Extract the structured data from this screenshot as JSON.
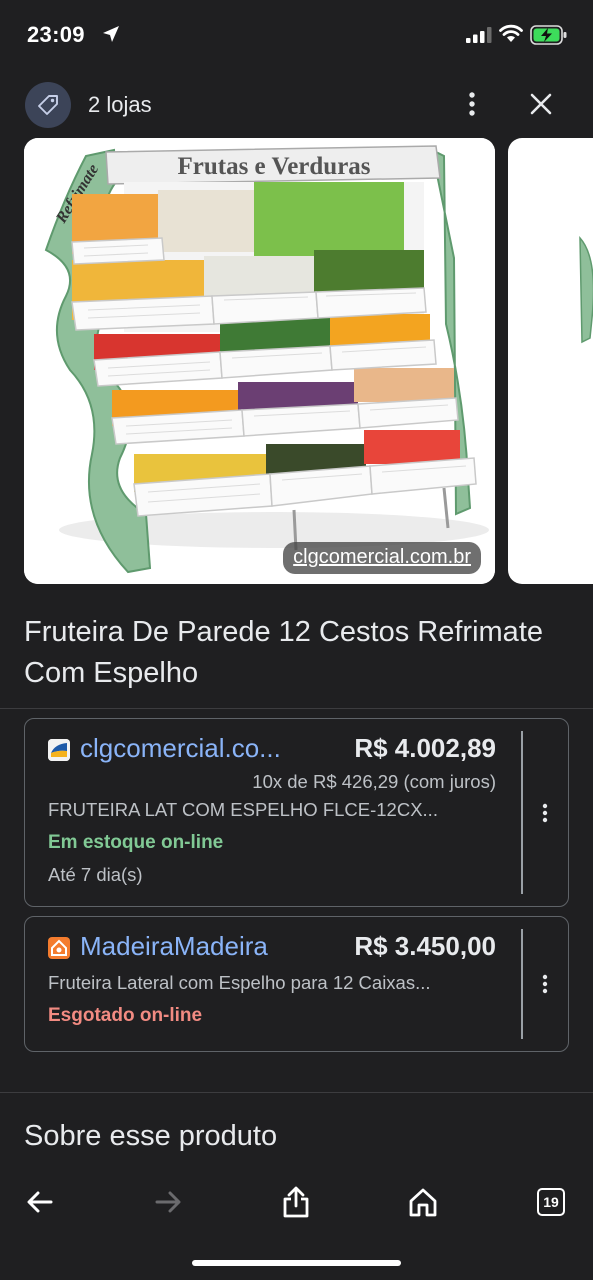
{
  "status_bar": {
    "time": "23:09"
  },
  "header": {
    "stores_count": "2 lojas",
    "icons": [
      "tag-icon",
      "more-vert-icon",
      "close-icon"
    ]
  },
  "image": {
    "sign_text": "Frutas e Verduras",
    "brand_text": "Refrimate",
    "source": "clgcomercial.com.br"
  },
  "product": {
    "title": "Fruteira De Parede 12 Cestos Refrimate Com Espelho"
  },
  "offers": [
    {
      "store": "clgcomercial.co...",
      "price": "R$ 4.002,89",
      "installments": "10x de R$ 426,29 (com juros)",
      "description": "FRUTEIRA LAT COM ESPELHO FLCE-12CX...",
      "stock": "Em estoque on-line",
      "delivery": "Até 7 dia(s)"
    },
    {
      "store": "MadeiraMadeira",
      "price": "R$ 3.450,00",
      "description": "Fruteira Lateral com Espelho para 12 Caixas...",
      "stock": "Esgotado on-line"
    }
  ],
  "about": {
    "title": "Sobre esse produto"
  },
  "nav": {
    "tabs_count": "19"
  },
  "colors": {
    "background": "#1f1f21",
    "link": "#8ab4f8",
    "in_stock": "#81c995",
    "out_of_stock": "#f28b82"
  }
}
